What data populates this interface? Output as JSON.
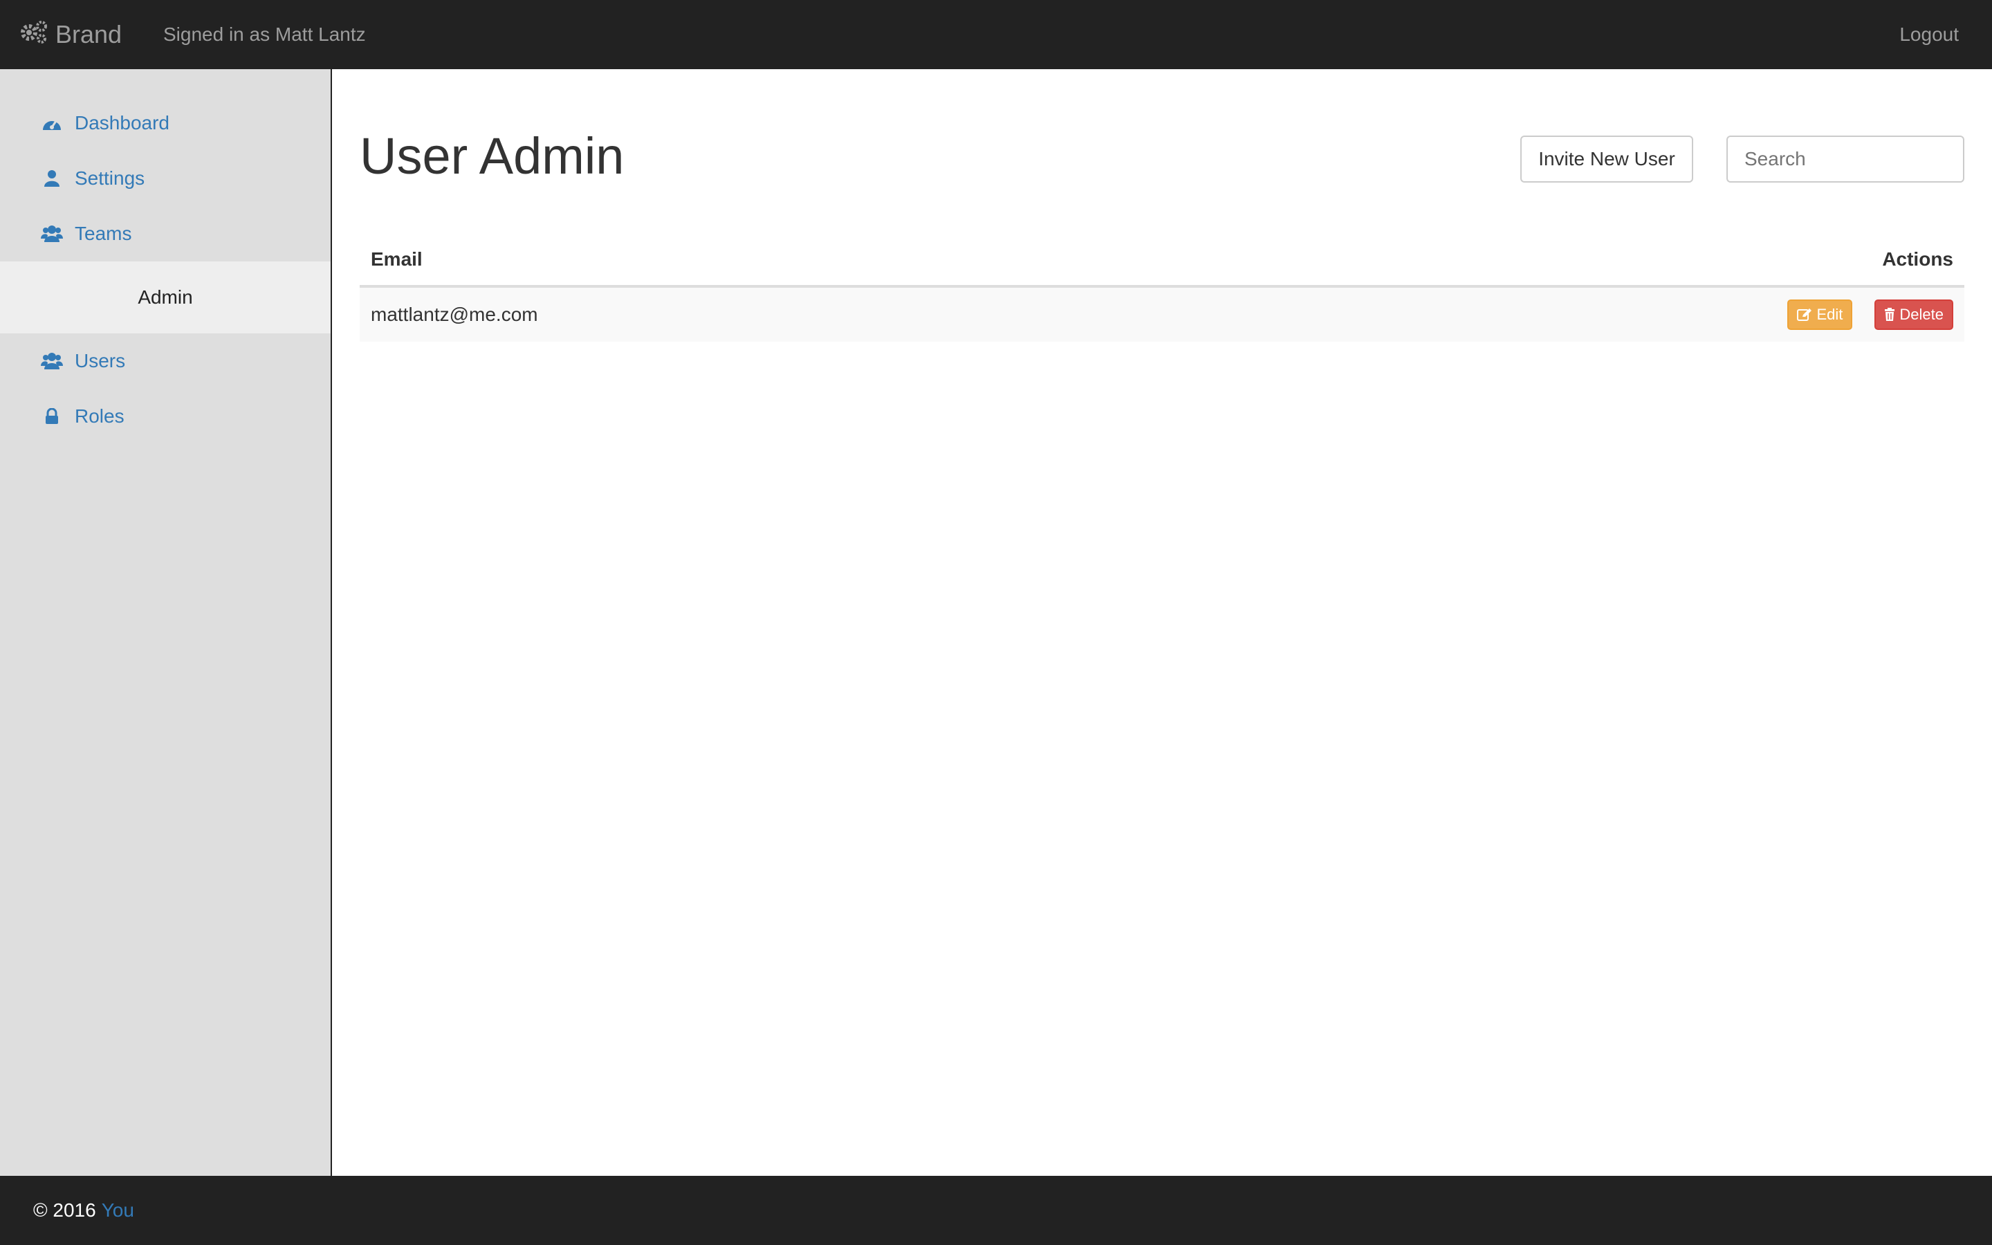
{
  "navbar": {
    "brand": "Brand",
    "signed_in": "Signed in as Matt Lantz",
    "logout": "Logout"
  },
  "sidebar": {
    "items": [
      {
        "label": "Dashboard",
        "icon": "dashboard-icon"
      },
      {
        "label": "Settings",
        "icon": "user-icon"
      },
      {
        "label": "Teams",
        "icon": "users-icon"
      }
    ],
    "group_label": "Admin",
    "admin_items": [
      {
        "label": "Users",
        "icon": "users-icon"
      },
      {
        "label": "Roles",
        "icon": "lock-icon"
      }
    ]
  },
  "main": {
    "title": "User Admin",
    "invite_button": "Invite New User",
    "search_placeholder": "Search",
    "table": {
      "headers": {
        "email": "Email",
        "actions": "Actions"
      },
      "rows": [
        {
          "email": "mattlantz@me.com",
          "edit": "Edit",
          "delete": "Delete"
        }
      ]
    }
  },
  "footer": {
    "copyright": "© 2016",
    "link": "You"
  },
  "colors": {
    "navbar_bg": "#222222",
    "link": "#337ab7",
    "edit": "#f0ad4e",
    "delete": "#d9534f",
    "sidebar_bg": "#dedede"
  }
}
